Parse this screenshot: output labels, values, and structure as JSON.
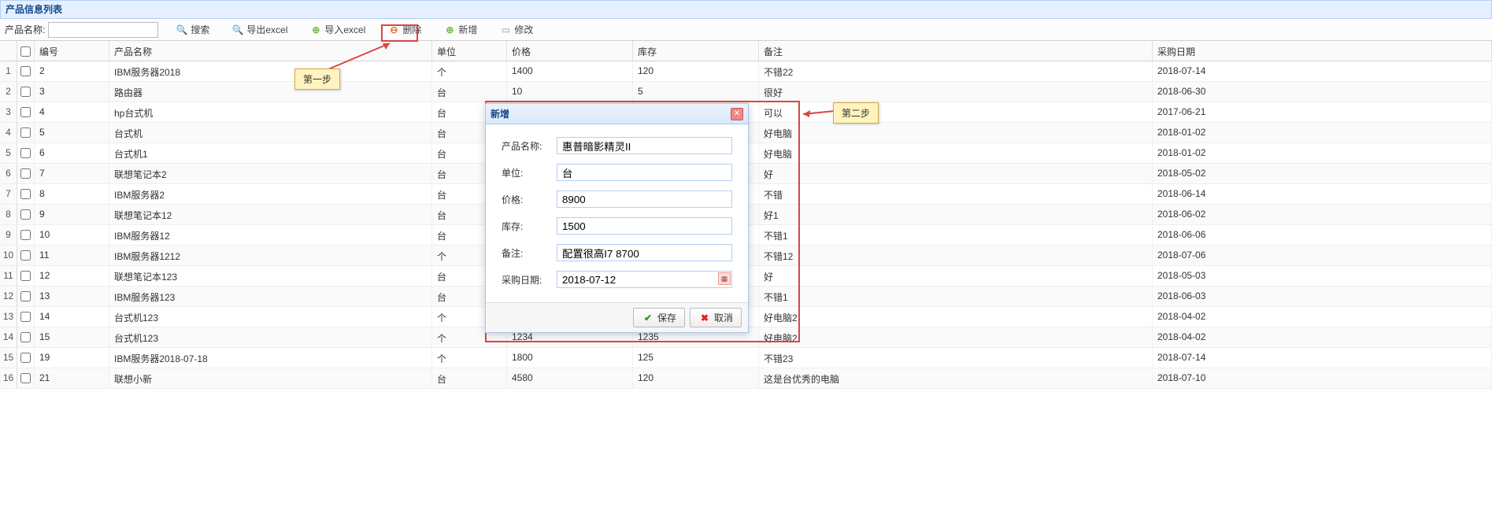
{
  "panel": {
    "title": "产品信息列表"
  },
  "toolbar": {
    "name_label": "产品名称:",
    "search_placeholder": "",
    "search_label": "搜索",
    "export_label": "导出excel",
    "import_label": "导入excel",
    "delete_label": "删除",
    "add_label": "新增",
    "edit_label": "修改"
  },
  "columns": {
    "c0": "",
    "id": "编号",
    "name": "产品名称",
    "unit": "单位",
    "price": "价格",
    "stock": "库存",
    "remark": "备注",
    "date": "采购日期"
  },
  "rows": [
    {
      "rn": "1",
      "id": "2",
      "name": "IBM服务器2018",
      "unit": "个",
      "price": "1400",
      "stock": "120",
      "remark": "不错22",
      "date": "2018-07-14"
    },
    {
      "rn": "2",
      "id": "3",
      "name": "路由器",
      "unit": "台",
      "price": "10",
      "stock": "5",
      "remark": "很好",
      "date": "2018-06-30"
    },
    {
      "rn": "3",
      "id": "4",
      "name": "hp台式机",
      "unit": "台",
      "price": "",
      "stock": "",
      "remark": "可以",
      "date": "2017-06-21"
    },
    {
      "rn": "4",
      "id": "5",
      "name": "台式机",
      "unit": "台",
      "price": "",
      "stock": "",
      "remark": "好电脑",
      "date": "2018-01-02"
    },
    {
      "rn": "5",
      "id": "6",
      "name": "台式机1",
      "unit": "台",
      "price": "",
      "stock": "",
      "remark": "好电脑",
      "date": "2018-01-02"
    },
    {
      "rn": "6",
      "id": "7",
      "name": "联想笔记本2",
      "unit": "台",
      "price": "",
      "stock": "",
      "remark": "好",
      "date": "2018-05-02"
    },
    {
      "rn": "7",
      "id": "8",
      "name": "IBM服务器2",
      "unit": "台",
      "price": "",
      "stock": "",
      "remark": "不错",
      "date": "2018-06-14"
    },
    {
      "rn": "8",
      "id": "9",
      "name": "联想笔记本12",
      "unit": "台",
      "price": "",
      "stock": "",
      "remark": "好1",
      "date": "2018-06-02"
    },
    {
      "rn": "9",
      "id": "10",
      "name": "IBM服务器12",
      "unit": "台",
      "price": "",
      "stock": "",
      "remark": "不错1",
      "date": "2018-06-06"
    },
    {
      "rn": "10",
      "id": "11",
      "name": "IBM服务器1212",
      "unit": "个",
      "price": "",
      "stock": "",
      "remark": "不错12",
      "date": "2018-07-06"
    },
    {
      "rn": "11",
      "id": "12",
      "name": "联想笔记本123",
      "unit": "台",
      "price": "",
      "stock": "",
      "remark": "好",
      "date": "2018-05-03"
    },
    {
      "rn": "12",
      "id": "13",
      "name": "IBM服务器123",
      "unit": "台",
      "price": "",
      "stock": "",
      "remark": "不错1",
      "date": "2018-06-03"
    },
    {
      "rn": "13",
      "id": "14",
      "name": "台式机123",
      "unit": "个",
      "price": "",
      "stock": "",
      "remark": "好电脑2",
      "date": "2018-04-02"
    },
    {
      "rn": "14",
      "id": "15",
      "name": "台式机123",
      "unit": "个",
      "price": "1234",
      "stock": "1235",
      "remark": "好电脑2",
      "date": "2018-04-02"
    },
    {
      "rn": "15",
      "id": "19",
      "name": "IBM服务器2018-07-18",
      "unit": "个",
      "price": "1800",
      "stock": "125",
      "remark": "不错23",
      "date": "2018-07-14"
    },
    {
      "rn": "16",
      "id": "21",
      "name": "联想小新",
      "unit": "台",
      "price": "4580",
      "stock": "120",
      "remark": "这是台优秀的电脑",
      "date": "2018-07-10"
    }
  ],
  "dialog": {
    "title": "新增",
    "fields": {
      "name_label": "产品名称:",
      "name_value": "惠普暗影精灵II",
      "unit_label": "单位:",
      "unit_value": "台",
      "price_label": "价格:",
      "price_value": "8900",
      "stock_label": "库存:",
      "stock_value": "1500",
      "remark_label": "备注:",
      "remark_value": "配置很高I7 8700",
      "date_label": "采购日期:",
      "date_value": "2018-07-12"
    },
    "save_label": "保存",
    "cancel_label": "取消"
  },
  "annotations": {
    "step1": "第一步",
    "step2": "第二步"
  }
}
